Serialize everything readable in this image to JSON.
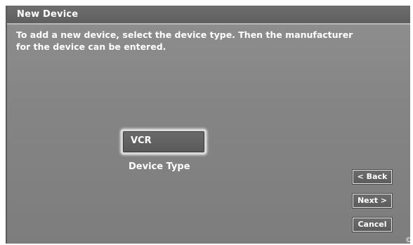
{
  "window": {
    "title": "New Device"
  },
  "instructions": {
    "line1": "To add a new device, select the device type.  Then the manufacturer",
    "line2": "for the device can be entered."
  },
  "device_type": {
    "value": "VCR",
    "label": "Device Type"
  },
  "buttons": {
    "back": "< Back",
    "next": "Next >",
    "cancel": "Cancel"
  },
  "icons": {
    "copyright": "copyright-icon"
  },
  "colors": {
    "panel_background": "#858585",
    "title_bar": "#666666",
    "text": "#ffffff",
    "selector_highlight": "#d9d9d9"
  }
}
